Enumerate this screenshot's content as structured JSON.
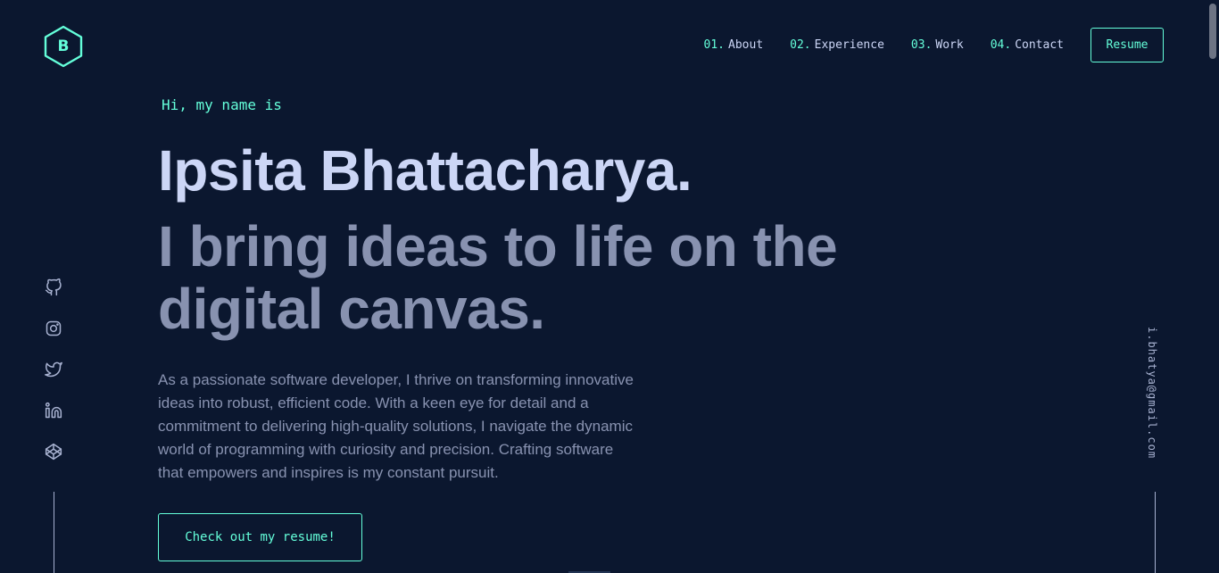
{
  "logo": {
    "letter": "B"
  },
  "nav": {
    "items": [
      {
        "num": "01.",
        "label": "About"
      },
      {
        "num": "02.",
        "label": "Experience"
      },
      {
        "num": "03.",
        "label": "Work"
      },
      {
        "num": "04.",
        "label": "Contact"
      }
    ],
    "resume_label": "Resume"
  },
  "hero": {
    "greeting": "Hi, my name is",
    "name": "Ipsita Bhattacharya.",
    "tagline": "I bring ideas to life on the digital canvas.",
    "bio": "As a passionate software developer, I thrive on transforming innovative ideas into robust, efficient code. With a keen eye for detail and a commitment to delivering high-quality solutions, I navigate the dynamic world of programming with curiosity and precision. Crafting software that empowers and inspires is my constant pursuit.",
    "cta_label": "Check out my resume!"
  },
  "socials": [
    "github-icon",
    "instagram-icon",
    "twitter-icon",
    "linkedin-icon",
    "codepen-icon"
  ],
  "email": "i.bhatya@gmail.com",
  "colors": {
    "background": "#0b172f",
    "accent": "#64ffda",
    "heading": "#ccd6f6",
    "text": "#8892b0"
  }
}
